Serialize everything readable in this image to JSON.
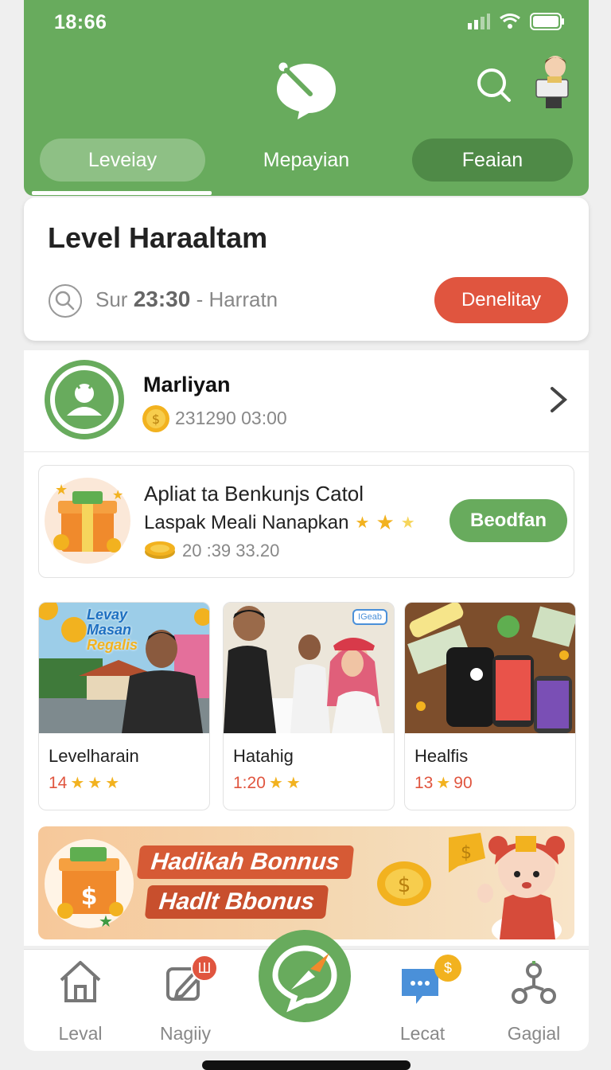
{
  "status_bar": {
    "time": "18:66"
  },
  "header": {
    "tabs": [
      {
        "label": "Leveiay",
        "active": true
      },
      {
        "label": "Mepayian"
      },
      {
        "label": "Feaian"
      }
    ]
  },
  "level_card": {
    "title": "Level Haraaltam",
    "sub_prefix": "Sur",
    "sub_time": "23:30",
    "sub_suffix": "- Harratn",
    "button": "Denelitay"
  },
  "profile": {
    "name": "Marliyan",
    "meta": "231290 03:00"
  },
  "promo": {
    "title": "Apliat ta Benkunjs Catol",
    "subtitle": "Laspak Meali Nanapkan",
    "meta": "20 :39 33.20",
    "button": "Beodfan"
  },
  "cards": [
    {
      "title": "Levelharain",
      "meta": "14",
      "image_text": [
        "Levay",
        "Masan",
        "Regalis"
      ]
    },
    {
      "title": "Hatahig",
      "meta": "1:20",
      "badge": "IGeab"
    },
    {
      "title": "Healfis",
      "meta_left": "13",
      "meta_right": "90"
    }
  ],
  "banner": {
    "line1": "Hadikah Bonnus",
    "line2": "Hadlt Bbonus"
  },
  "bottom_nav": [
    {
      "label": "Leval",
      "icon": "home-icon"
    },
    {
      "label": "Nagiiy",
      "icon": "edit-icon",
      "badge": "Ш"
    },
    {
      "label": "",
      "icon": "compass-icon"
    },
    {
      "label": "Lecat",
      "icon": "chat-coin-icon",
      "badge": "$"
    },
    {
      "label": "Gagial",
      "icon": "profile-network-icon"
    }
  ],
  "colors": {
    "brand_green": "#68ab5d",
    "accent_red": "#e0553f",
    "gold": "#f2b21f"
  }
}
